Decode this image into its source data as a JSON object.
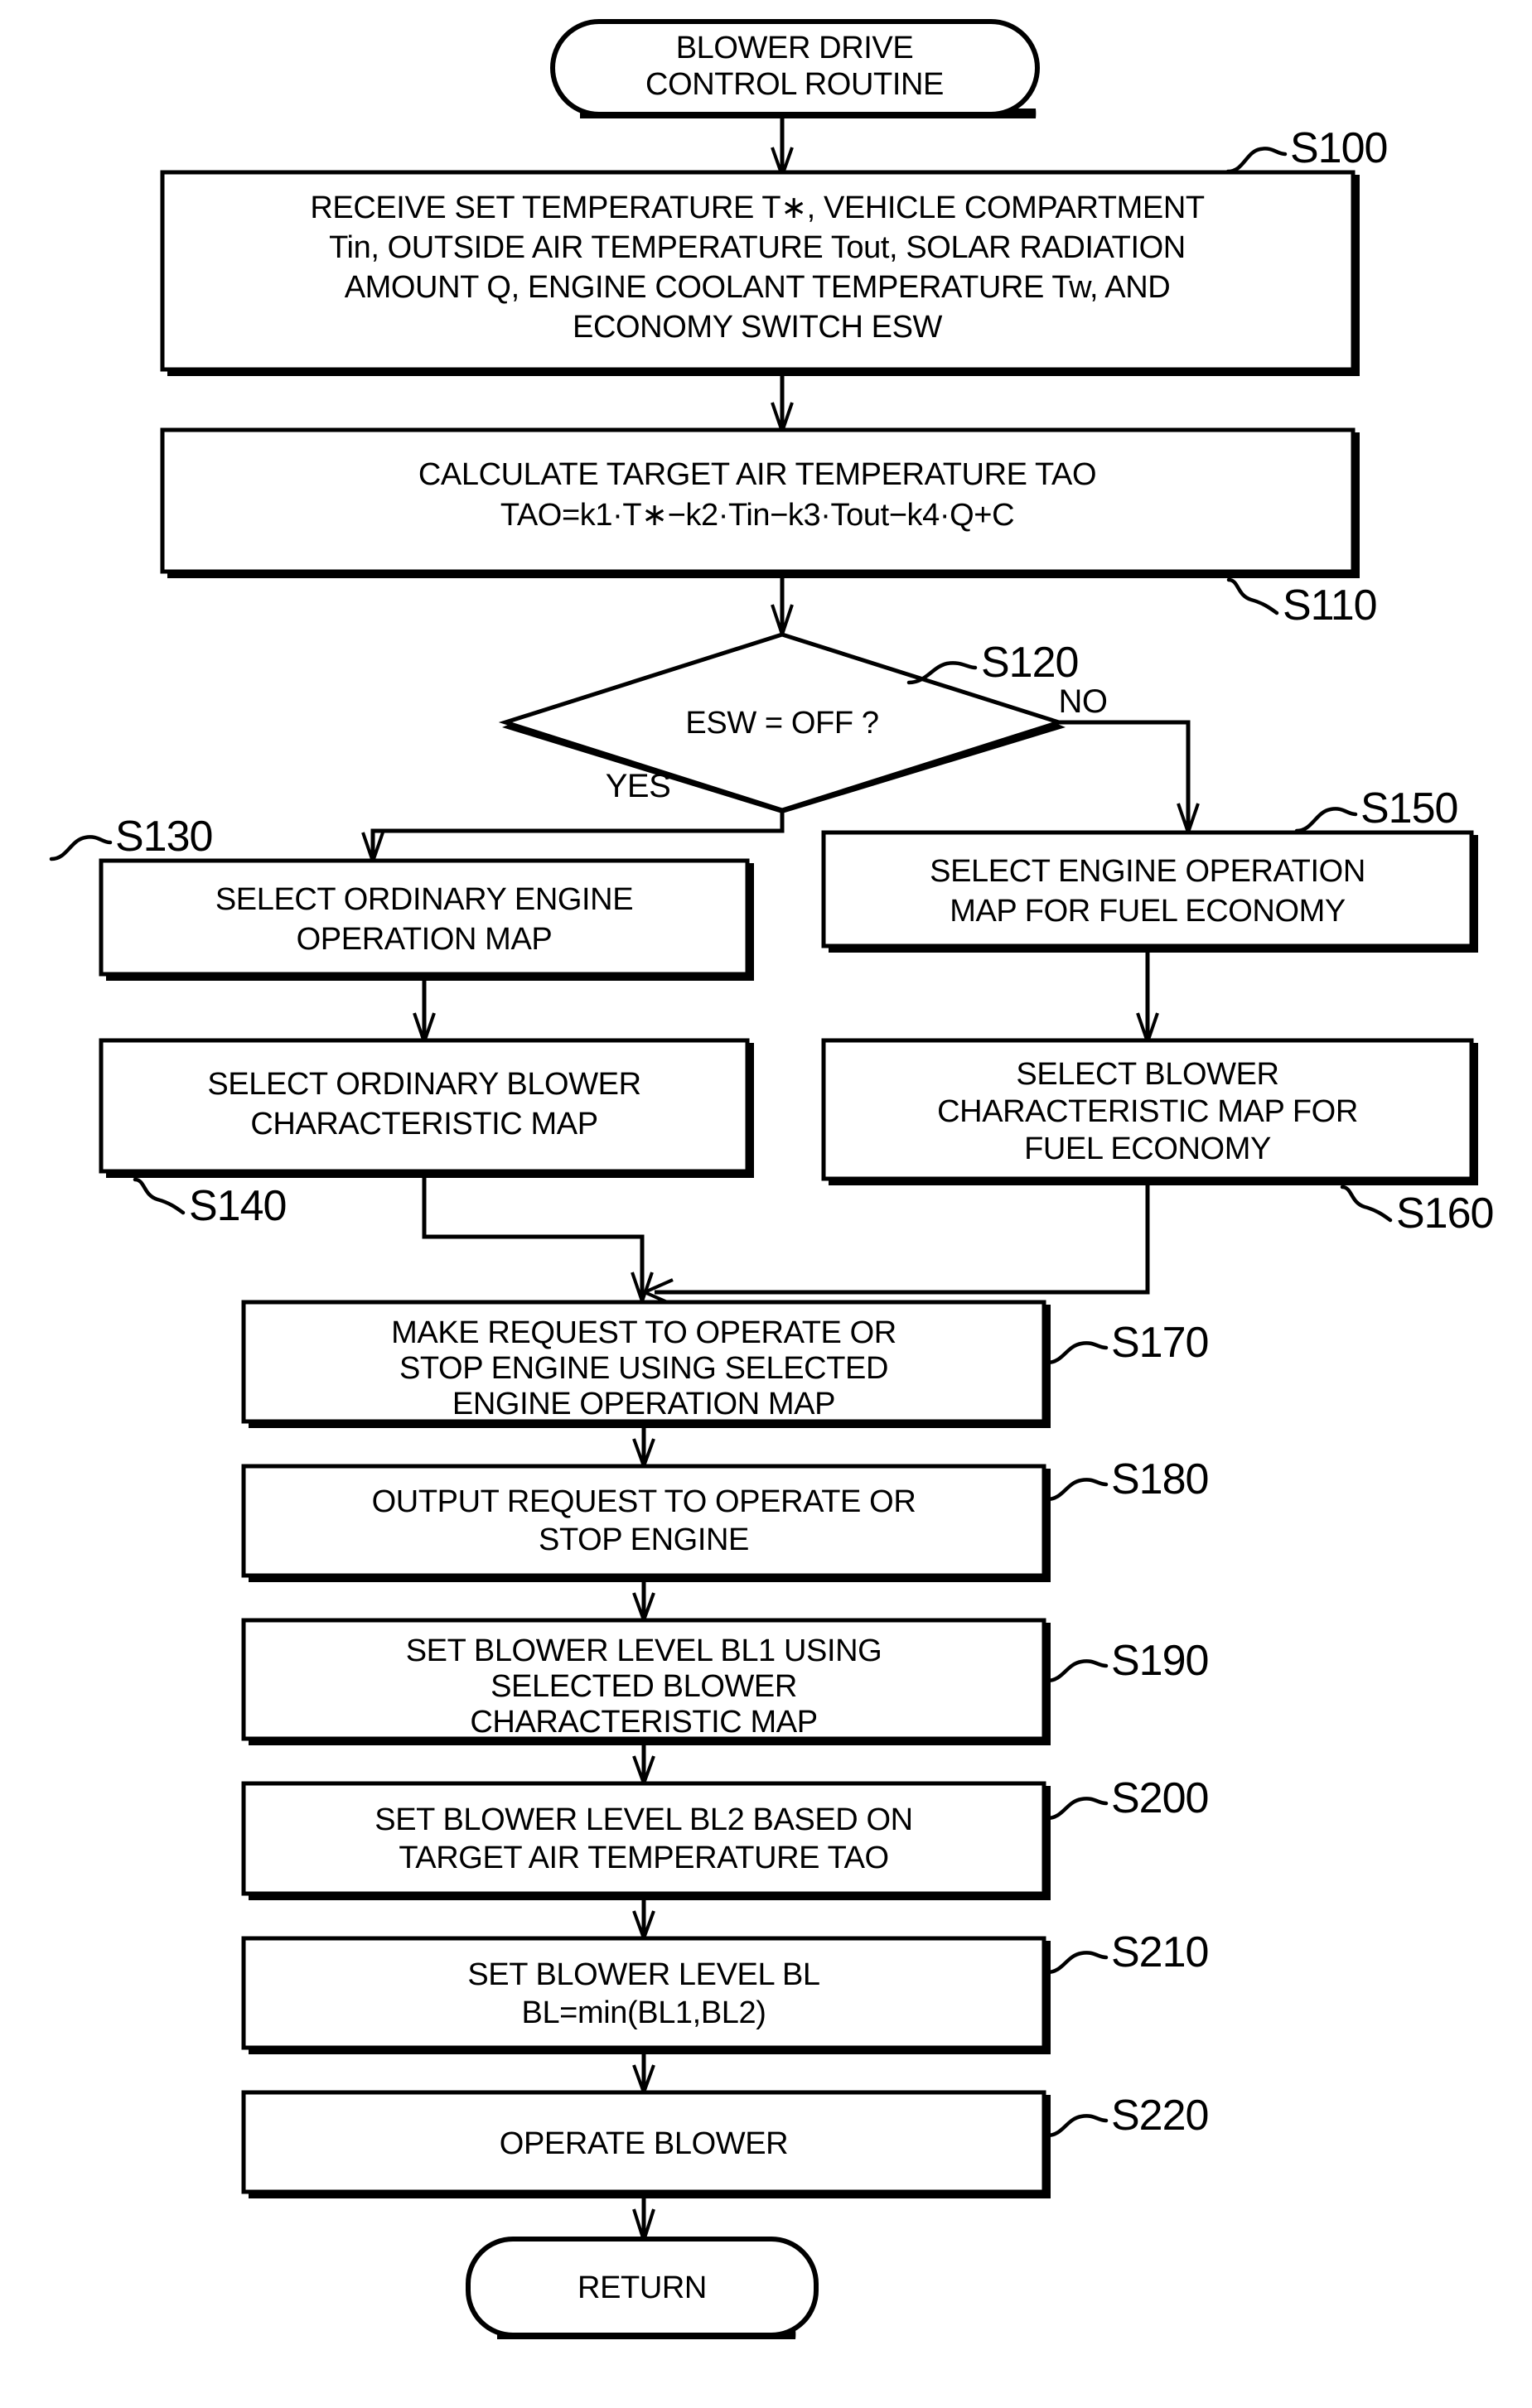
{
  "figure": {
    "type": "flowchart",
    "title": "BLOWER DRIVE CONTROL ROUTINE",
    "orientation": "vertical"
  },
  "terminals": {
    "start": {
      "label_line1": "BLOWER DRIVE",
      "label_line2": "CONTROL ROUTINE"
    },
    "end": {
      "label": "RETURN"
    }
  },
  "decision": {
    "step_label": "S120",
    "text": "ESW = OFF ?",
    "yes_label": "YES",
    "no_label": "NO"
  },
  "steps": {
    "s100": {
      "step_label": "S100",
      "line1": "RECEIVE SET TEMPERATURE T∗, VEHICLE COMPARTMENT",
      "line2": "Tin, OUTSIDE AIR TEMPERATURE Tout, SOLAR RADIATION",
      "line3": "AMOUNT Q, ENGINE COOLANT TEMPERATURE Tw, AND",
      "line4": "ECONOMY SWITCH ESW"
    },
    "s110": {
      "step_label": "S110",
      "line1": "CALCULATE TARGET AIR TEMPERATURE TAO",
      "line2": "TAO=k1·T∗−k2·Tin−k3·Tout−k4·Q+C"
    },
    "s130": {
      "step_label": "S130",
      "line1": "SELECT ORDINARY ENGINE",
      "line2": "OPERATION MAP"
    },
    "s140": {
      "step_label": "S140",
      "line1": "SELECT ORDINARY BLOWER",
      "line2": "CHARACTERISTIC MAP"
    },
    "s150": {
      "step_label": "S150",
      "line1": "SELECT ENGINE OPERATION",
      "line2": "MAP FOR FUEL ECONOMY"
    },
    "s160": {
      "step_label": "S160",
      "line1": "SELECT BLOWER",
      "line2": "CHARACTERISTIC MAP FOR",
      "line3": "FUEL ECONOMY"
    },
    "s170": {
      "step_label": "S170",
      "line1": "MAKE REQUEST TO OPERATE OR",
      "line2": "STOP ENGINE USING SELECTED",
      "line3": "ENGINE OPERATION MAP"
    },
    "s180": {
      "step_label": "S180",
      "line1": "OUTPUT REQUEST TO OPERATE OR",
      "line2": "STOP ENGINE"
    },
    "s190": {
      "step_label": "S190",
      "line1": "SET BLOWER LEVEL BL1 USING",
      "line2": "SELECTED BLOWER",
      "line3": "CHARACTERISTIC MAP"
    },
    "s200": {
      "step_label": "S200",
      "line1": "SET BLOWER LEVEL BL2 BASED ON",
      "line2": "TARGET AIR TEMPERATURE TAO"
    },
    "s210": {
      "step_label": "S210",
      "line1": "SET BLOWER LEVEL BL",
      "line2": "BL=min(BL1,BL2)"
    },
    "s220": {
      "step_label": "S220",
      "line1": "OPERATE BLOWER"
    }
  },
  "colors": {
    "ink": "#000000",
    "paper": "#ffffff"
  }
}
